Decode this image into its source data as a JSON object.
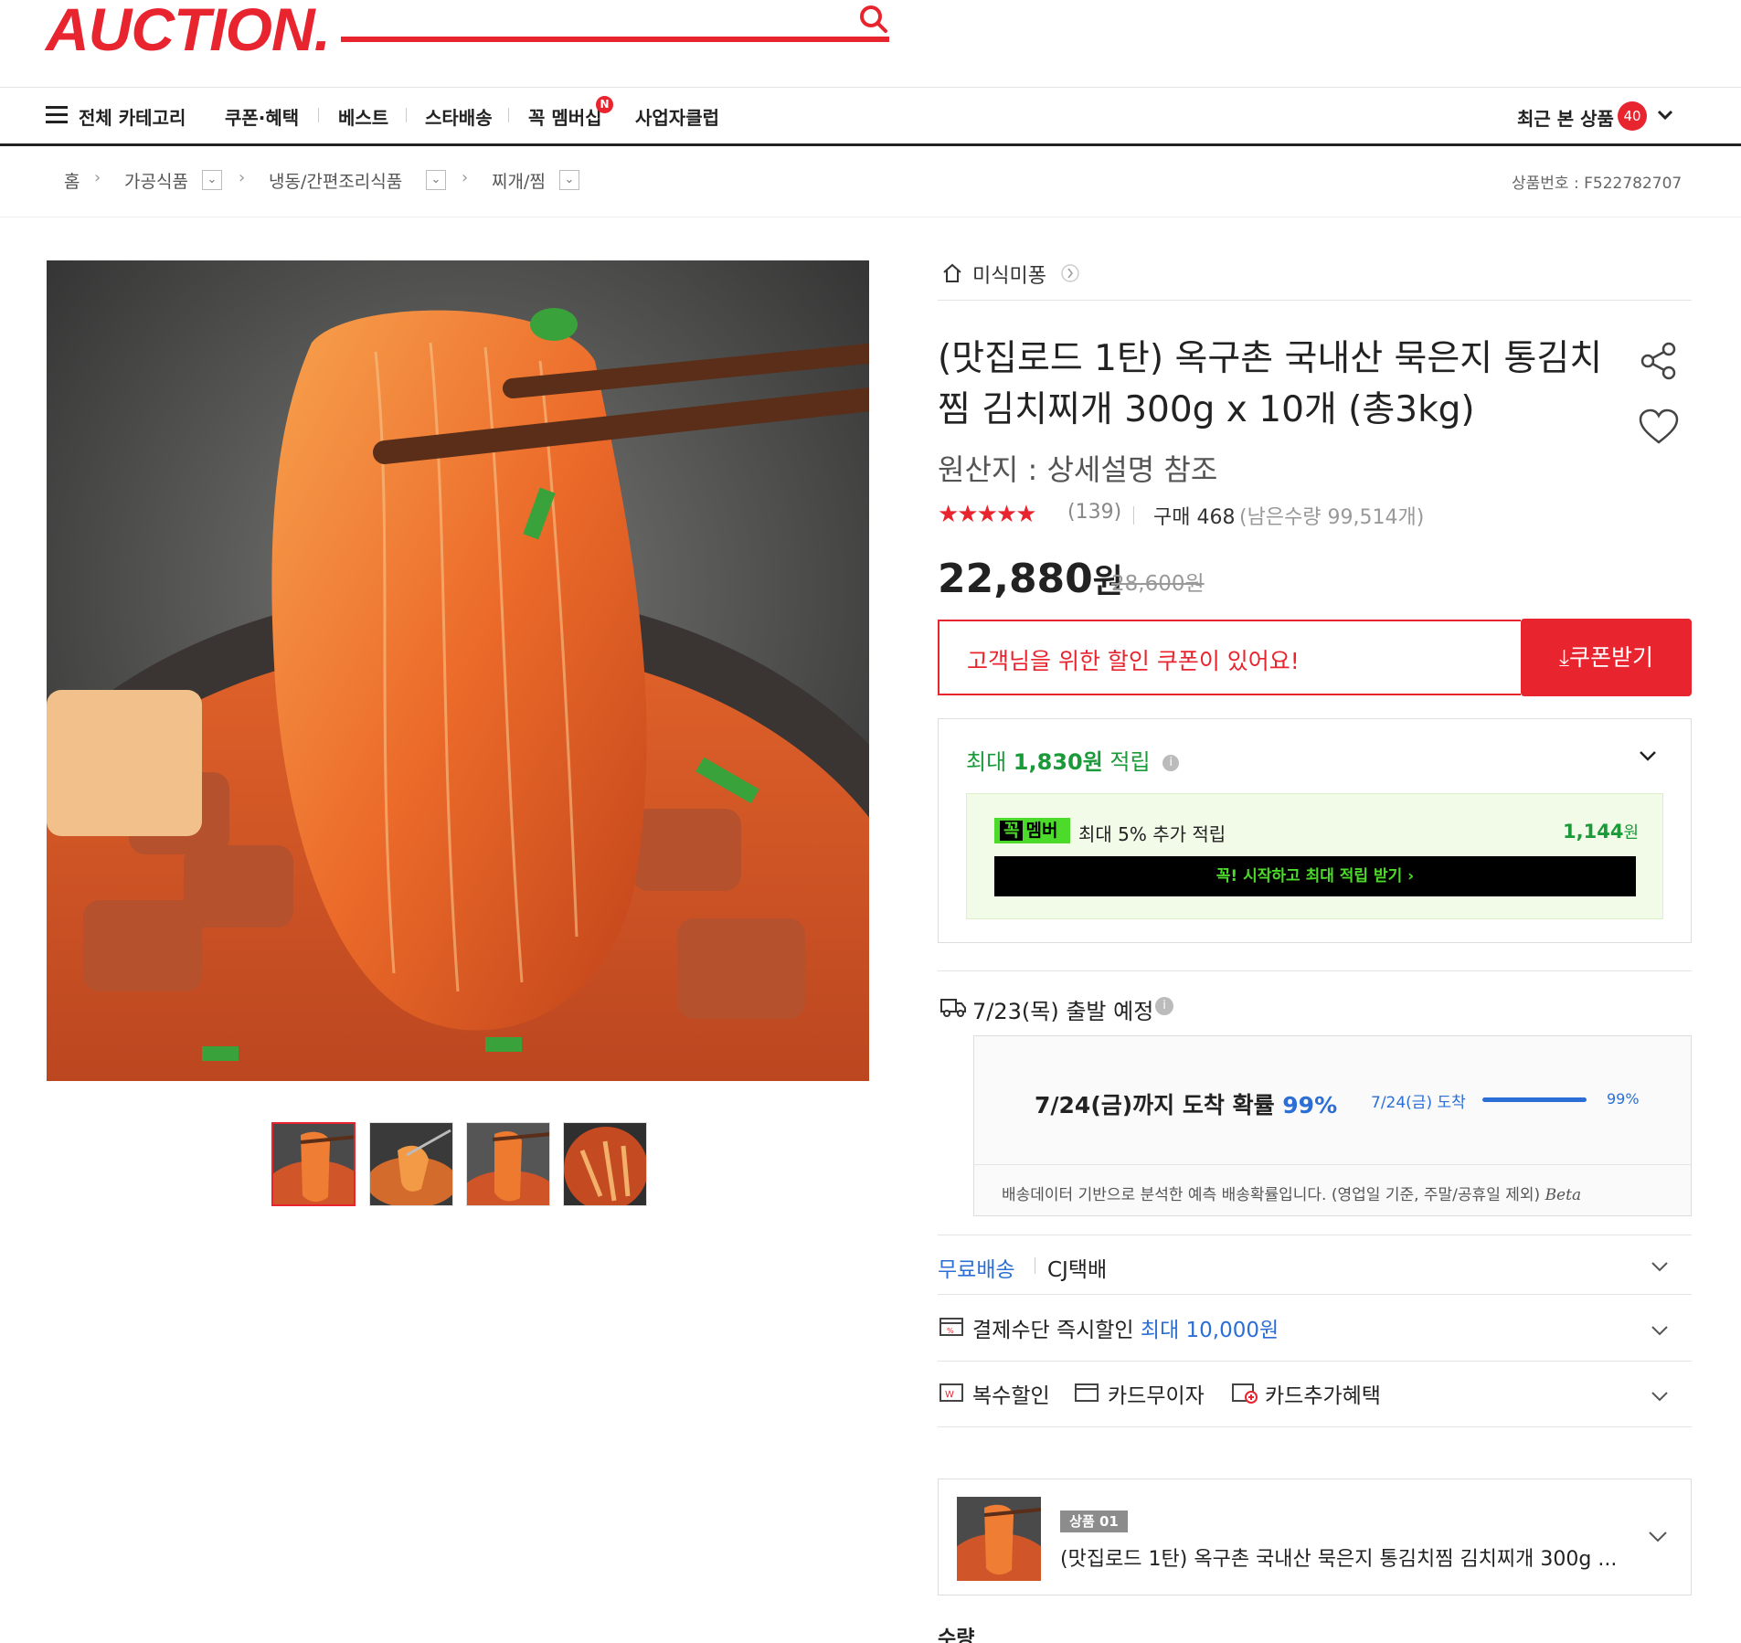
{
  "header": {
    "logo": "AUCTION.",
    "nav": {
      "all_category": "전체 카테고리",
      "items": [
        "쿠폰·혜택",
        "베스트",
        "스타배송",
        "꼭 멤버십",
        "사업자클럽"
      ],
      "new_badge": "N",
      "recent_label": "최근 본 상품",
      "recent_count": "40"
    }
  },
  "breadcrumb": {
    "items": [
      "홈",
      "가공식품",
      "냉동/간편조리식품",
      "찌개/찜"
    ],
    "product_no": "상품번호 : F522782707"
  },
  "product": {
    "store": "미식미퐁",
    "title": "(맛집로드 1탄) 옥구촌 국내산 묵은지 통김치찜 김치찌개 300g x 10개 (총3kg)",
    "origin": "원산지 : 상세설명 참조",
    "rating_count": "(139)",
    "rating_stars": 4.5,
    "purchase": "구매 468",
    "remaining": "(남은수량 99,514개)",
    "price": "22,880",
    "price_unit": "원",
    "original_price": "28,600원"
  },
  "coupon": {
    "message": "고객님을 위한 할인 쿠폰이 있어요!",
    "button": "쿠폰받기"
  },
  "points": {
    "prefix": "최대 ",
    "amount": "1,830원",
    "suffix": " 적립",
    "member_tag_a": "꼭",
    "member_tag_b": "멤버",
    "member_text": "최대 5% 추가 적립",
    "member_amount": "1,144",
    "member_amount_unit": "원",
    "member_cta": "꼭! 시작하고 최대 적립 받기 ›"
  },
  "shipping": {
    "date": "7/23(목) 출발 예정",
    "arrive_text": "7/24(금)까지 도착 확률 ",
    "arrive_pct": "99%",
    "arrive_small": "7/24(금) 도착",
    "bar_pct": "99%",
    "bar_fraction": 0.99,
    "note": "배송데이터 기반으로 분석한 예측 배송확률입니다. (영업일 기준, 주말/공휴일 제외)",
    "beta": "Beta"
  },
  "options": {
    "free_ship": "무료배송",
    "carrier": "CJ택배",
    "payment_label": "결제수단 즉시할인 ",
    "payment_max": "최대 10,000원",
    "multi_discount": "복수할인",
    "card_interest": "카드무이자",
    "card_extra": "카드추가혜택"
  },
  "selected_item": {
    "tag": "상품 01",
    "name": "(맛집로드 1탄) 옥구촌 국내산 묵은지 통김치찜 김치찌개 300g ..."
  },
  "quantity_label": "수량",
  "colors": {
    "brand": "#e8242f",
    "point_green": "#1b9a3a",
    "info_blue": "#2b6fd6"
  }
}
